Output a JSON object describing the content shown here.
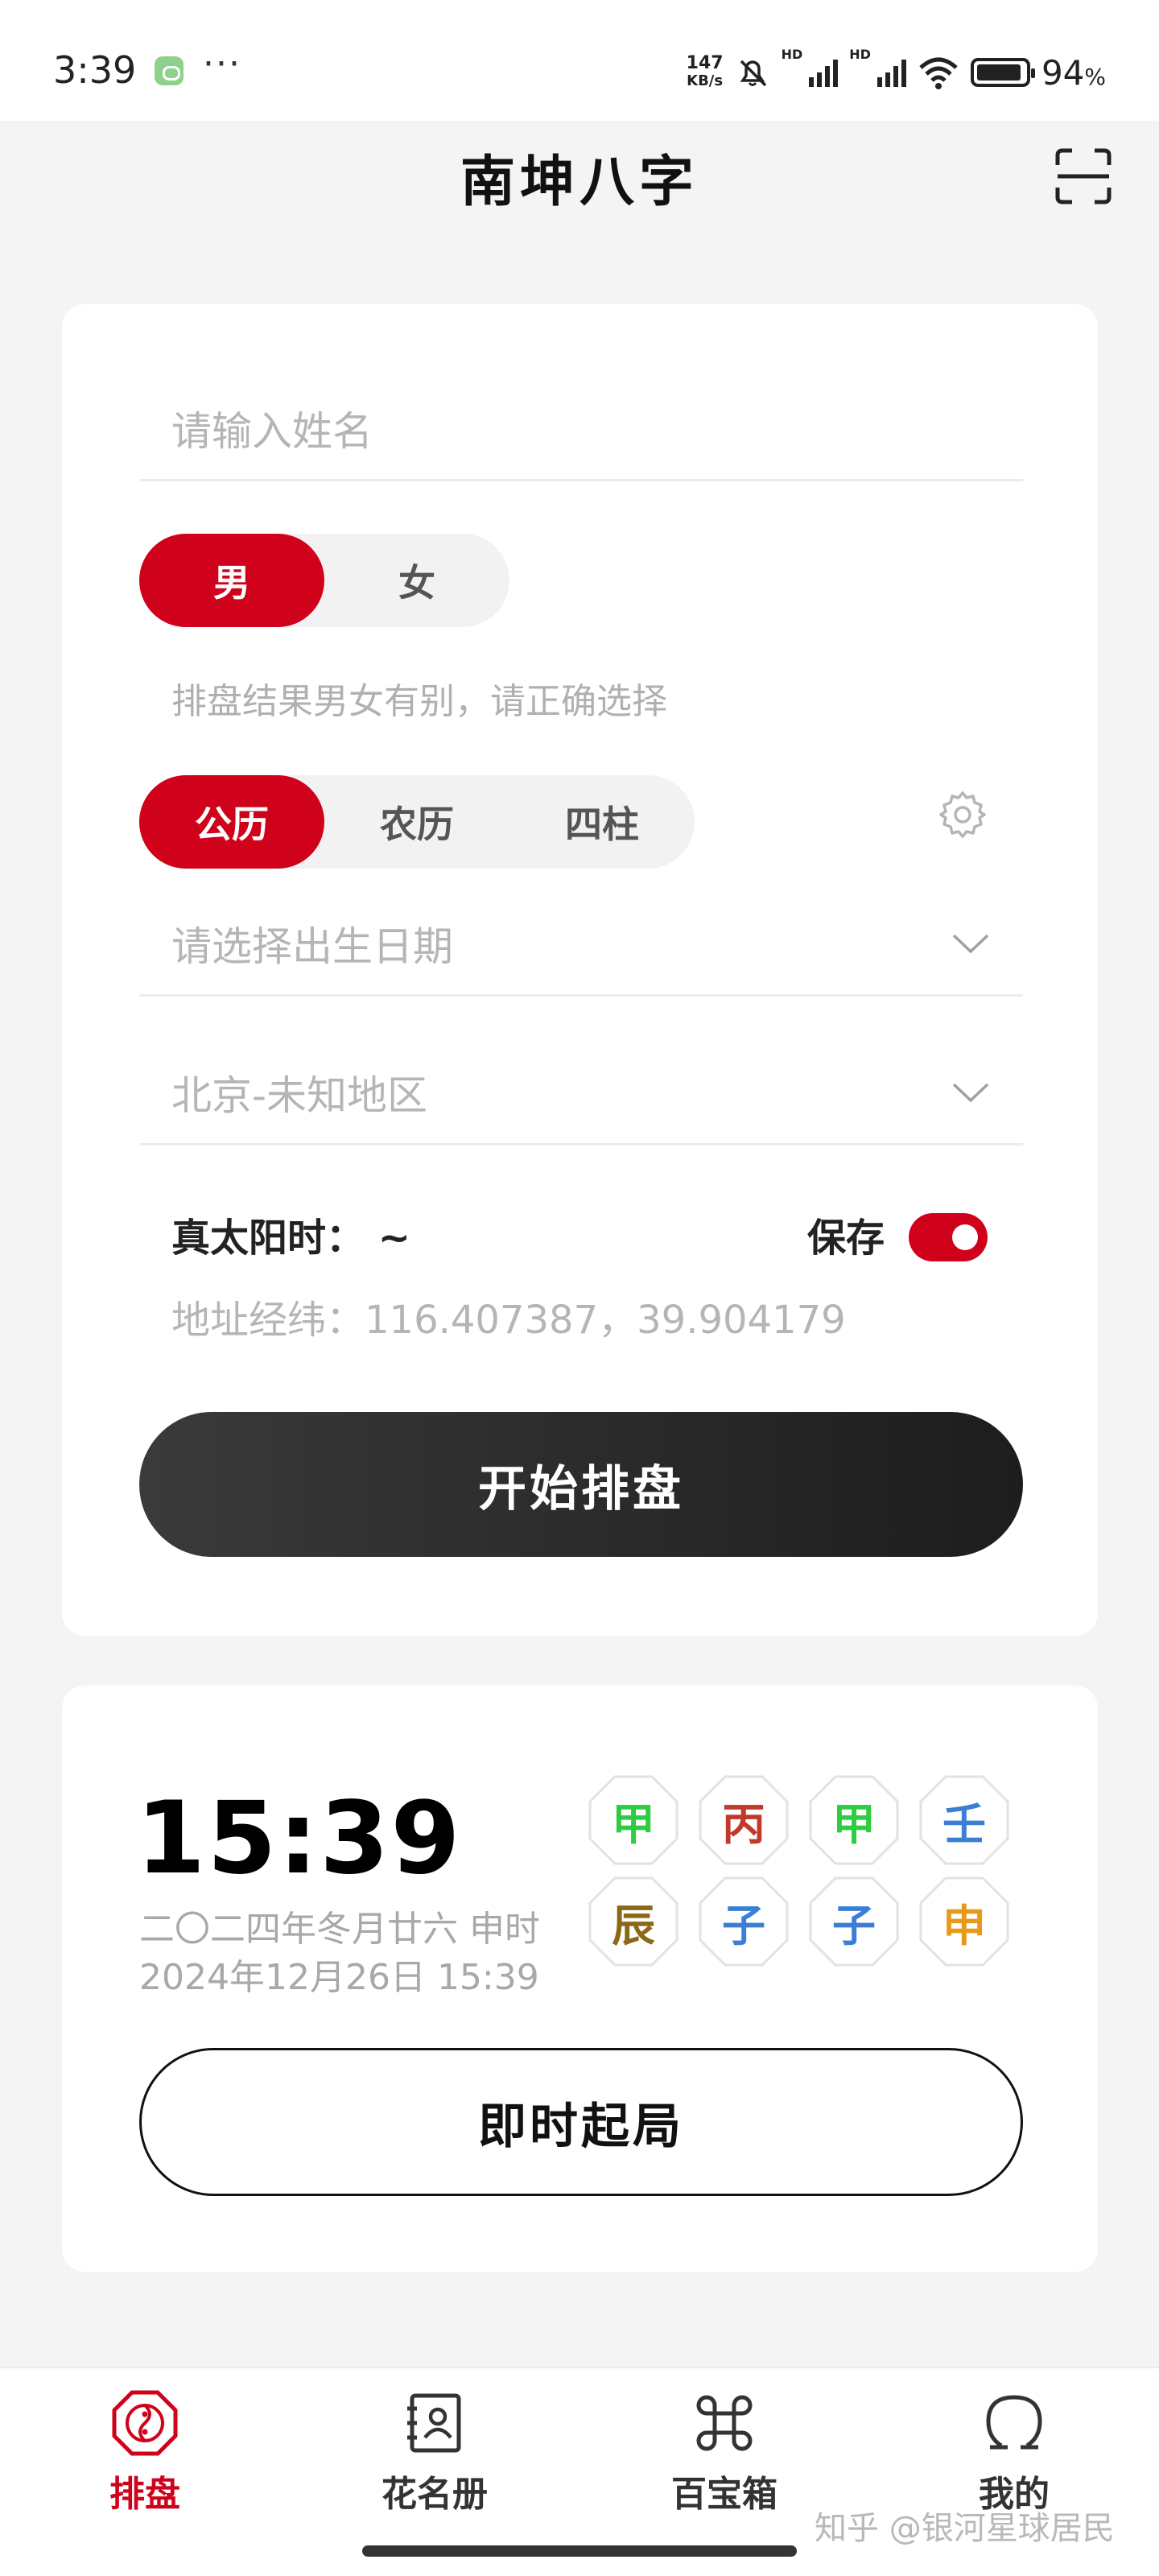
{
  "status_bar": {
    "time": "3:39",
    "dots": "···",
    "net_speed_value": "147",
    "net_speed_unit": "KB/s",
    "hd1": "HD",
    "hd2": "HD",
    "battery_percent": "94",
    "battery_percent_sign": "%",
    "battery_level": 0.94
  },
  "header": {
    "title": "南坤八字"
  },
  "form": {
    "name_placeholder": "请输入姓名",
    "gender_options": [
      "男",
      "女"
    ],
    "gender_selected": "男",
    "gender_hint": "排盘结果男女有别，请正确选择",
    "calendar_options": [
      "公历",
      "农历",
      "四柱"
    ],
    "calendar_selected": "公历",
    "birth_date_placeholder": "请选择出生日期",
    "location": "北京-未知地区",
    "true_solar_time": "真太阳时：  ~",
    "save_label": "保存",
    "save_enabled": true,
    "address_coords": "地址经纬：116.407387，39.904179",
    "start_button": "开始排盘"
  },
  "now_card": {
    "clock": "15:39",
    "lunar_date": "二〇二四年冬月廿六 申时",
    "solar_date": "2024年12月26日 15:39",
    "stems": [
      {
        "char": "甲",
        "color": "#2ecc40"
      },
      {
        "char": "丙",
        "color": "#c0392b"
      },
      {
        "char": "甲",
        "color": "#2ecc40"
      },
      {
        "char": "壬",
        "color": "#3a7fd5"
      }
    ],
    "branches": [
      {
        "char": "辰",
        "color": "#8b6914"
      },
      {
        "char": "子",
        "color": "#3a7fd5"
      },
      {
        "char": "子",
        "color": "#3a7fd5"
      },
      {
        "char": "申",
        "color": "#e69a1a"
      }
    ],
    "instant_button": "即时起局"
  },
  "tabbar": {
    "tabs": [
      {
        "label": "排盘",
        "active": true
      },
      {
        "label": "花名册",
        "active": false
      },
      {
        "label": "百宝箱",
        "active": false
      },
      {
        "label": "我的",
        "active": false
      }
    ]
  },
  "watermark": "知乎 @银河星球居民",
  "colors": {
    "accent": "#d0021b",
    "background": "#f4f4f4",
    "card": "#ffffff"
  }
}
